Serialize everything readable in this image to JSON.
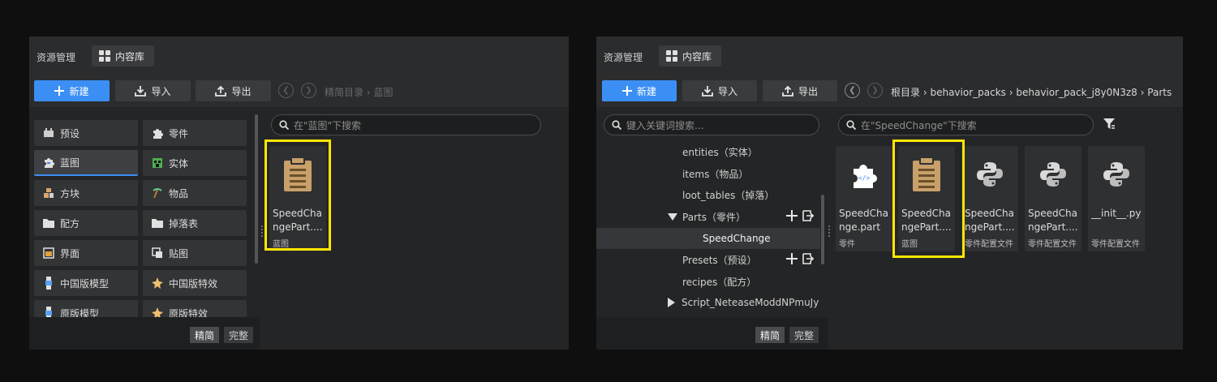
{
  "colors": {
    "accent": "#3b8ff4",
    "highlight": "#ffe600",
    "blueprint_icon": "#c8a06a"
  },
  "left": {
    "title": "资源管理",
    "view_tab": "内容库",
    "new_label": "新建",
    "import_label": "导入",
    "export_label": "导出",
    "breadcrumb": [
      "精简目录",
      "蓝图"
    ],
    "search_placeholder": "在\"蓝图\"下搜索",
    "categories": [
      {
        "label": "预设",
        "icon": "preset-icon"
      },
      {
        "label": "零件",
        "icon": "puzzle-icon"
      },
      {
        "label": "蓝图",
        "icon": "blueprint-icon"
      },
      {
        "label": "实体",
        "icon": "entity-icon"
      },
      {
        "label": "方块",
        "icon": "blocks-icon"
      },
      {
        "label": "物品",
        "icon": "pickaxe-icon"
      },
      {
        "label": "配方",
        "icon": "folder-icon"
      },
      {
        "label": "掉落表",
        "icon": "folder-icon"
      },
      {
        "label": "界面",
        "icon": "ui-icon"
      },
      {
        "label": "贴图",
        "icon": "texture-icon"
      },
      {
        "label": "中国版模型",
        "icon": "model-icon"
      },
      {
        "label": "中国版特效",
        "icon": "effect-icon"
      },
      {
        "label": "原版模型",
        "icon": "model-icon"
      },
      {
        "label": "原版特效",
        "icon": "effect-icon"
      }
    ],
    "mode_simple": "精简",
    "mode_full": "完整",
    "files": [
      {
        "name": "SpeedChangePart....",
        "kind": "蓝图",
        "icon": "clipboard-icon"
      }
    ]
  },
  "right": {
    "title": "资源管理",
    "view_tab": "内容库",
    "new_label": "新建",
    "import_label": "导入",
    "export_label": "导出",
    "breadcrumb": [
      "根目录",
      "behavior_packs",
      "behavior_pack_j8y0N3z8",
      "Parts"
    ],
    "tree_search_placeholder": "键入关键词搜索...",
    "search_placeholder": "在\"SpeedChange\"下搜索",
    "tree": [
      {
        "label": "entities（实体）"
      },
      {
        "label": "items（物品）"
      },
      {
        "label": "loot_tables（掉落）"
      },
      {
        "label": "Parts（零件）"
      },
      {
        "label": "SpeedChange"
      },
      {
        "label": "Presets（预设）"
      },
      {
        "label": "recipes（配方）"
      },
      {
        "label": "Script_NeteaseModdNPmuJy"
      }
    ],
    "mode_simple": "精简",
    "mode_full": "完整",
    "files": [
      {
        "name": "SpeedChange.part",
        "kind": "零件",
        "icon": "puzzle-code-icon"
      },
      {
        "name": "SpeedChangePart....",
        "kind": "蓝图",
        "icon": "clipboard-icon"
      },
      {
        "name": "SpeedChangePart....",
        "kind": "零件配置文件",
        "icon": "python-icon"
      },
      {
        "name": "SpeedChangePart....",
        "kind": "零件配置文件",
        "icon": "python-icon"
      },
      {
        "name": "__init__.py",
        "kind": "零件配置文件",
        "icon": "python-icon"
      }
    ]
  }
}
